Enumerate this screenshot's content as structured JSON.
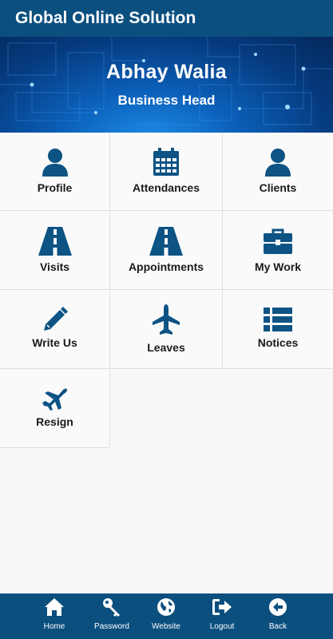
{
  "header": {
    "title": "Global Online Solution"
  },
  "profile": {
    "name": "Abhay Walia",
    "role": "Business Head"
  },
  "menu": [
    {
      "label": "Profile",
      "icon": "user-icon"
    },
    {
      "label": "Attendances",
      "icon": "calendar-icon"
    },
    {
      "label": "Clients",
      "icon": "user-icon"
    },
    {
      "label": "Visits",
      "icon": "road-icon"
    },
    {
      "label": "Appointments",
      "icon": "road-icon"
    },
    {
      "label": "My Work",
      "icon": "briefcase-icon"
    },
    {
      "label": "Write Us",
      "icon": "pencil-icon"
    },
    {
      "label": "Leaves",
      "icon": "airplane-icon"
    },
    {
      "label": "Notices",
      "icon": "list-icon"
    },
    {
      "label": "Resign",
      "icon": "plane-icon"
    }
  ],
  "bottom_nav": [
    {
      "label": "Home",
      "icon": "home-icon"
    },
    {
      "label": "Password",
      "icon": "key-icon"
    },
    {
      "label": "Website",
      "icon": "globe-icon"
    },
    {
      "label": "Logout",
      "icon": "logout-icon"
    },
    {
      "label": "Back",
      "icon": "back-arrow-icon"
    }
  ],
  "colors": {
    "primary": "#0b4f7f",
    "icon": "#0d5384"
  }
}
